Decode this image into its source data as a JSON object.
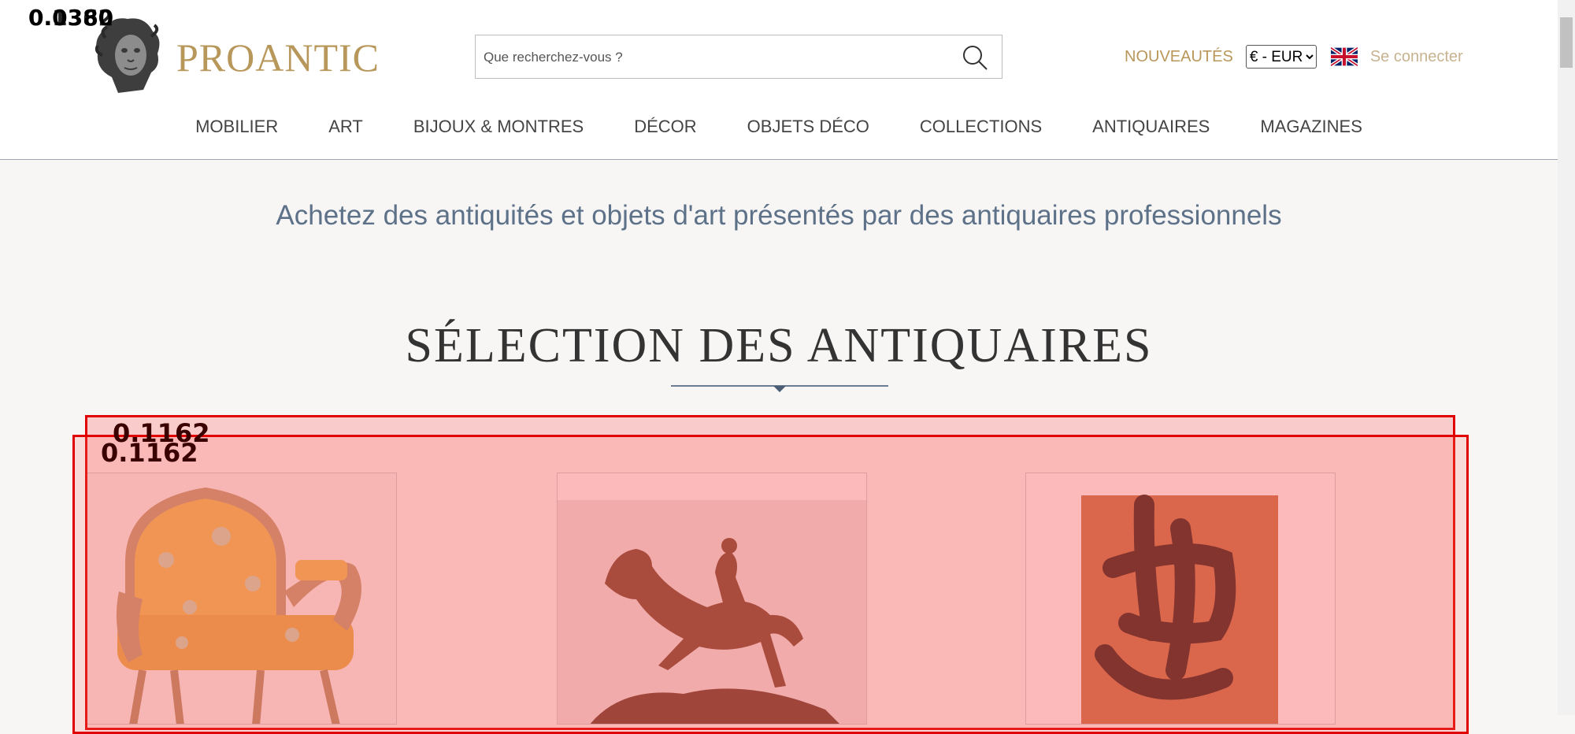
{
  "header": {
    "brand": "PROANTIC",
    "logo_icon": "medusa-bust-icon",
    "search": {
      "placeholder": "Que recherchez-vous ?",
      "icon": "search-icon"
    },
    "new_link": "NOUVEAUTÉS",
    "currency": {
      "selected": "€ - EUR"
    },
    "flag_icon": "uk-flag-icon",
    "login": "Se connecter"
  },
  "nav": {
    "items": [
      {
        "label": "MOBILIER"
      },
      {
        "label": "ART"
      },
      {
        "label": "BIJOUX & MONTRES"
      },
      {
        "label": "DÉCOR"
      },
      {
        "label": "OBJETS DÉCO"
      },
      {
        "label": "COLLECTIONS"
      },
      {
        "label": "ANTIQUAIRES"
      },
      {
        "label": "MAGAZINES"
      }
    ]
  },
  "main": {
    "tagline": "Achetez des antiquités et objets d'art présentés par des antiquaires professionnels",
    "section_title": "SÉLECTION DES ANTIQUAIRES",
    "cards": [
      {
        "image_icon": "louis-xv-sofa-image"
      },
      {
        "image_icon": "bronze-horse-rider-sculpture-image"
      },
      {
        "image_icon": "calligraphy-painting-image"
      }
    ]
  },
  "overlays": {
    "labels": [
      "0.1162",
      "0.1162",
      "0.0380",
      "0.1362"
    ],
    "color": "#e00000"
  },
  "colors": {
    "gold": "#b8975a",
    "slate": "#5d7189"
  }
}
